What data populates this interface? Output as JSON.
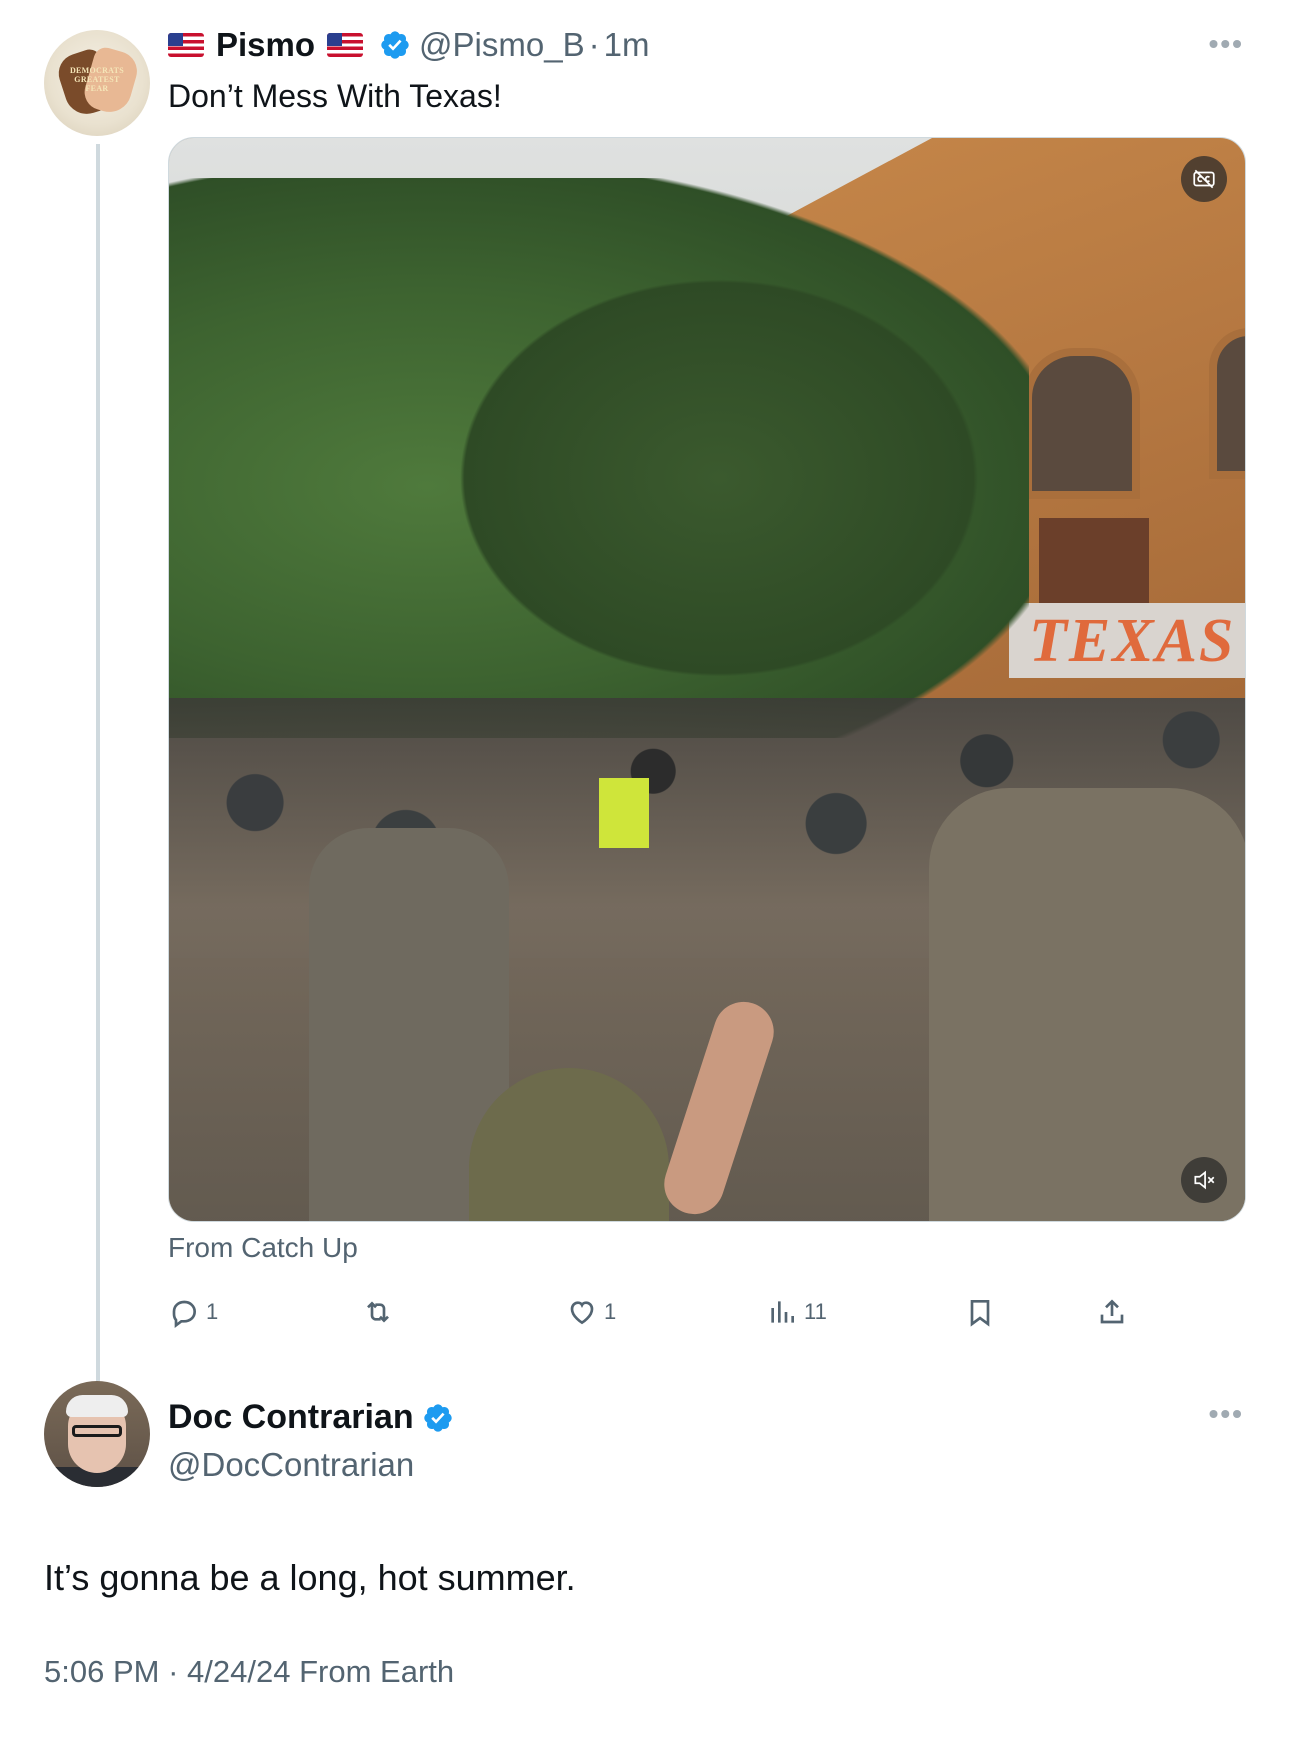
{
  "tweet1": {
    "display_name": "Pismo",
    "handle": "@Pismo_B",
    "separator": "·",
    "time_ago": "1m",
    "text": "Don’t Mess With Texas!",
    "avatar_text": "DEMOCRATS GREATEST FEAR",
    "media_sign_text": "TEXAS",
    "source_line": "From Catch Up",
    "actions": {
      "replies": "1",
      "reposts": "",
      "likes": "1",
      "views": "11"
    }
  },
  "tweet2": {
    "display_name": "Doc Contrarian",
    "handle": "@DocContrarian",
    "text": "It’s gonna be a long, hot summer.",
    "time": "5:06 PM",
    "separator": "·",
    "date": "4/24/24",
    "source": "From Earth"
  },
  "icons": {
    "verified": "verified-badge-icon",
    "more": "more-options-icon",
    "reply": "reply-icon",
    "repost": "repost-icon",
    "like": "like-icon",
    "views": "views-icon",
    "bookmark": "bookmark-icon",
    "share": "share-icon",
    "captions": "captions-off-icon",
    "mute": "muted-volume-icon"
  },
  "colors": {
    "verified_blue": "#1d9bf0",
    "secondary_text": "#536471",
    "thread_line": "#cfd9de"
  }
}
